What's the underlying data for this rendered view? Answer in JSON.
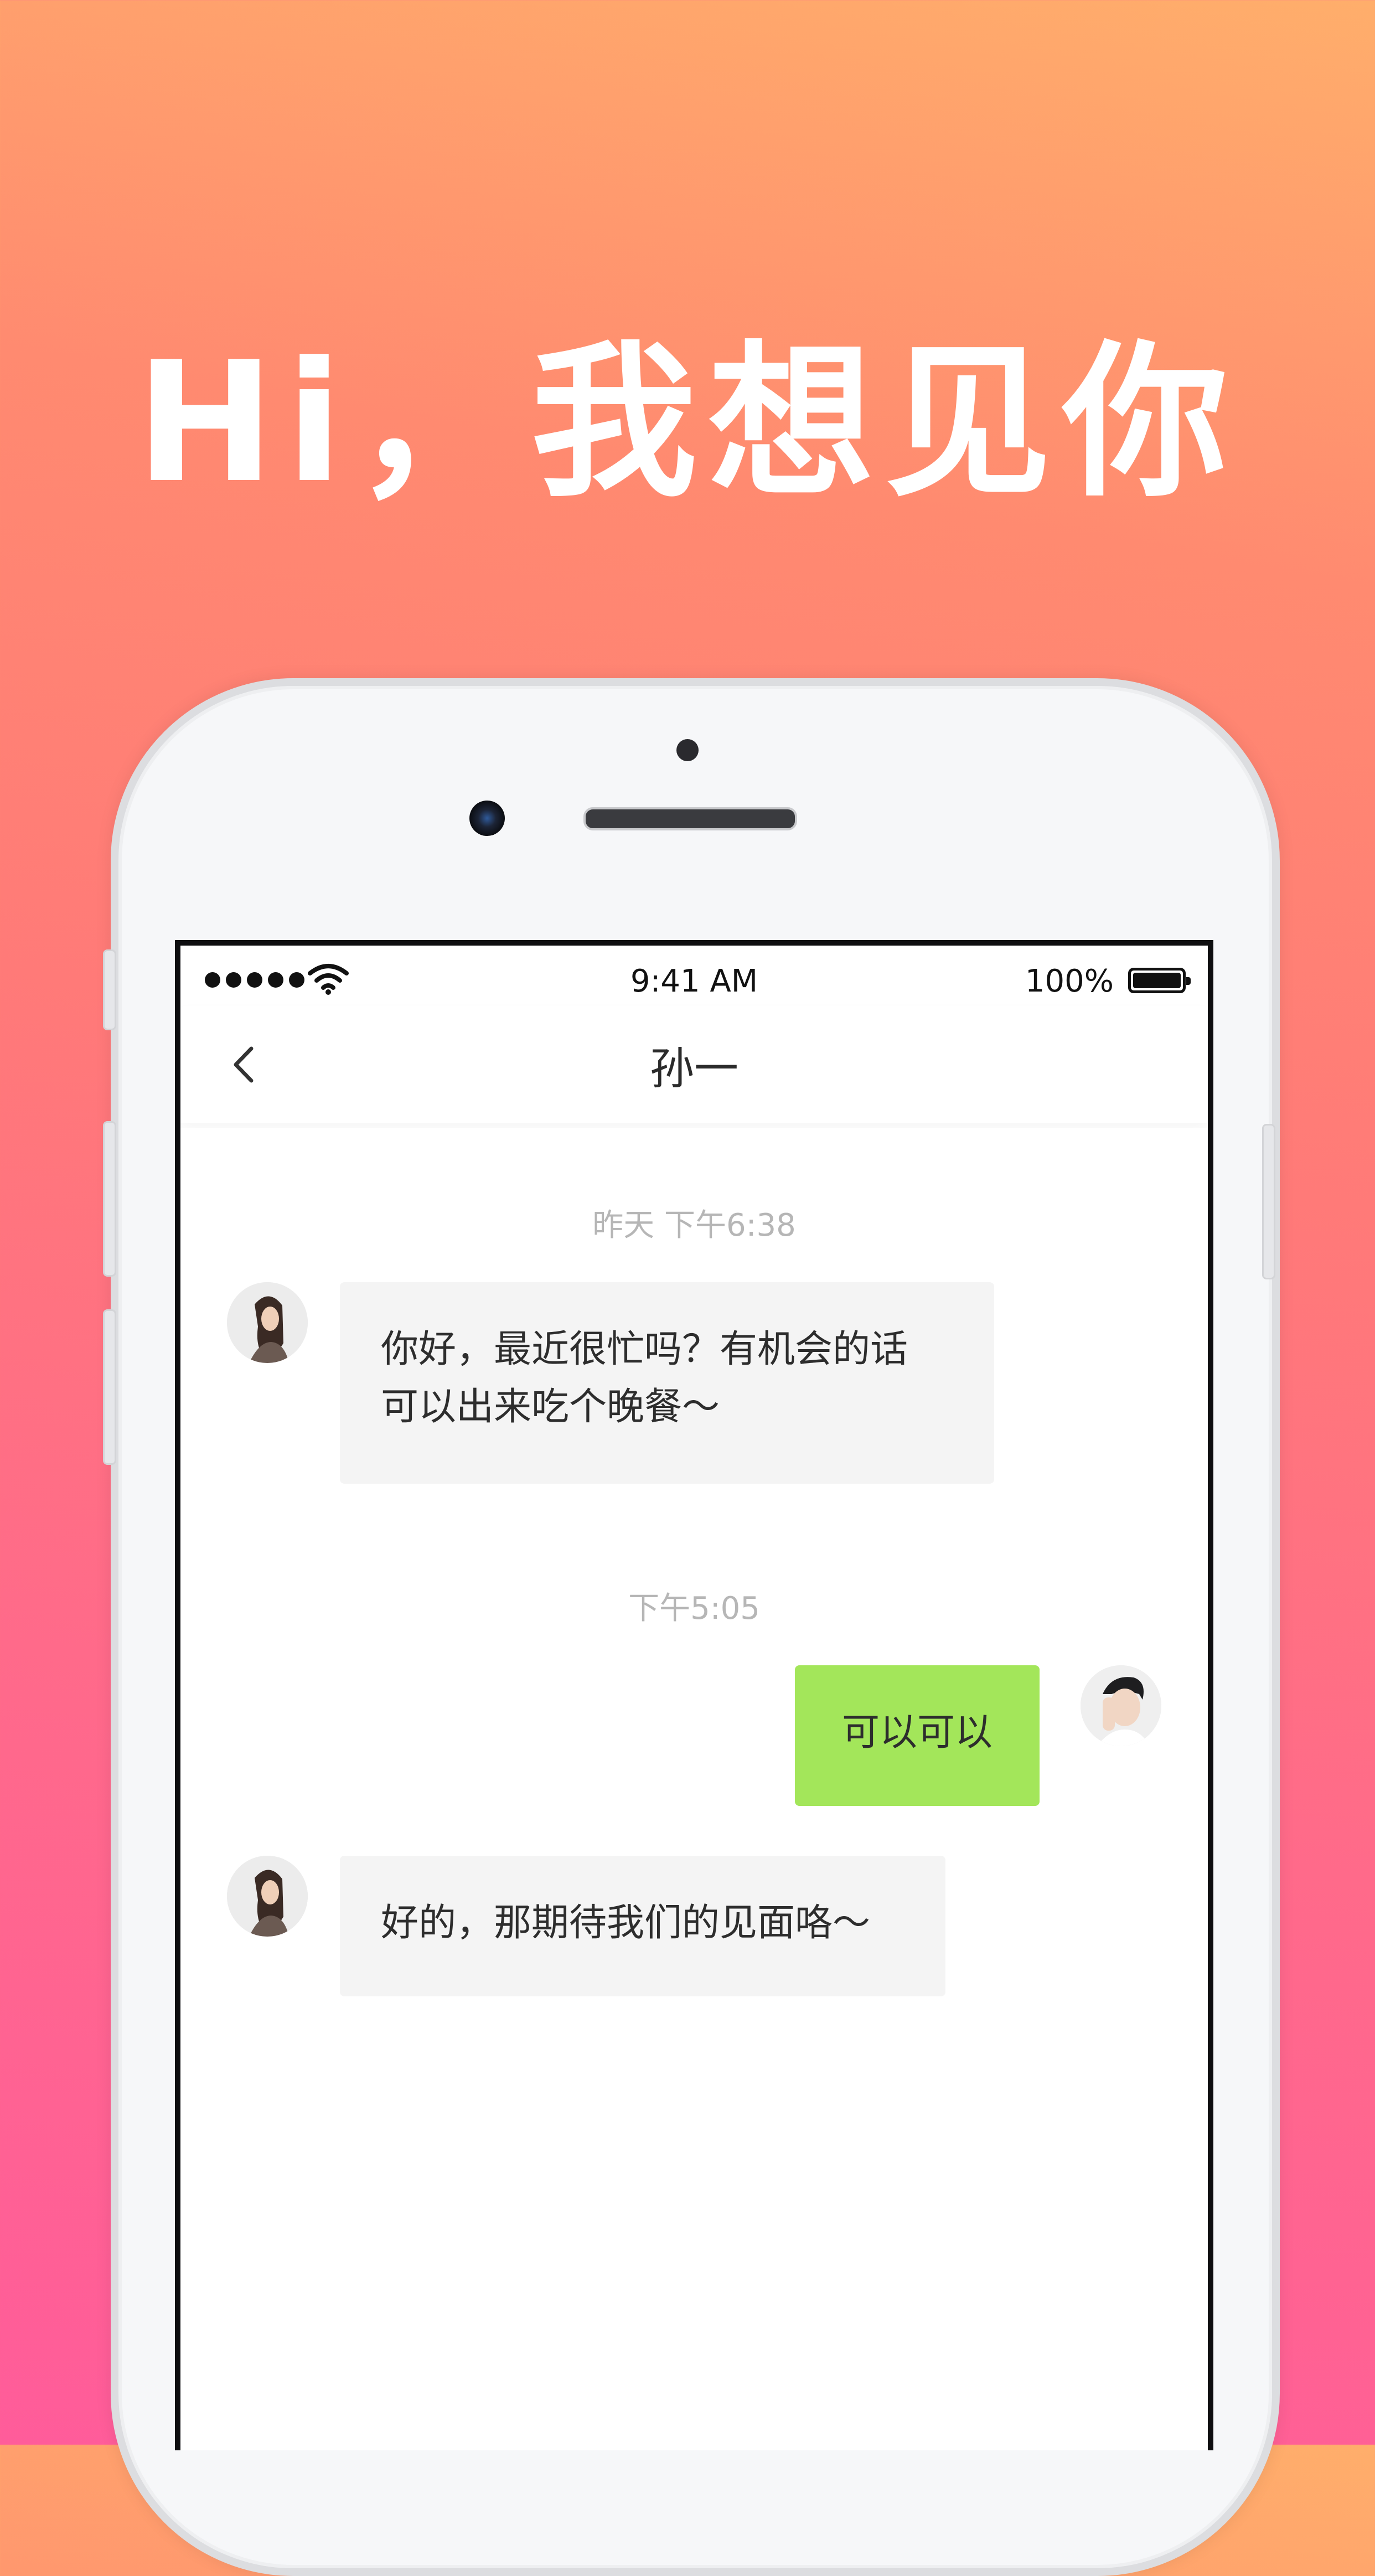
{
  "headline": "Hi，我想见你",
  "status_bar": {
    "time": "9:41 AM",
    "battery": "100%"
  },
  "nav": {
    "title": "孙一"
  },
  "messages": [
    {
      "timestamp": "昨天 下午6:38"
    },
    {
      "direction": "in",
      "text_line1": "你好，最近很忙吗？有机会的话",
      "text_line2": "可以出来吃个晚餐～"
    },
    {
      "timestamp": "下午5:05"
    },
    {
      "direction": "out",
      "text": "可以可以"
    },
    {
      "direction": "in",
      "text": "好的，那期待我们的见面咯～"
    }
  ],
  "colors": {
    "out_bubble": "#a3e65a",
    "in_bubble": "#f4f4f4",
    "timestamp": "#b6b6b6",
    "background_top": "#ffae6b",
    "background_bottom": "#ff5c9a"
  },
  "icons": [
    "back-chevron-icon",
    "signal-dots-icon",
    "wifi-icon",
    "battery-icon",
    "avatar-female",
    "avatar-male"
  ]
}
